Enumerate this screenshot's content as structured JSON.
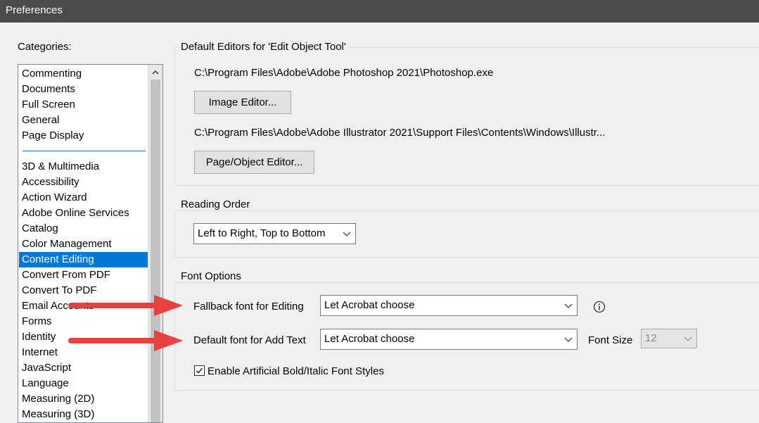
{
  "window": {
    "title": "Preferences"
  },
  "categories": {
    "label": "Categories:",
    "group1": [
      "Commenting",
      "Documents",
      "Full Screen",
      "General",
      "Page Display"
    ],
    "group2": [
      "3D & Multimedia",
      "Accessibility",
      "Action Wizard",
      "Adobe Online Services",
      "Catalog",
      "Color Management",
      "Content Editing",
      "Convert From PDF",
      "Convert To PDF",
      "Email Accounts",
      "Forms",
      "Identity",
      "Internet",
      "JavaScript",
      "Language",
      "Measuring (2D)",
      "Measuring (3D)"
    ],
    "selected": "Content Editing"
  },
  "default_editors": {
    "title": "Default Editors for 'Edit Object Tool'",
    "image_editor_path": "C:\\Program Files\\Adobe\\Adobe Photoshop 2021\\Photoshop.exe",
    "image_editor_button": "Image Editor...",
    "page_object_editor_path": "C:\\Program Files\\Adobe\\Adobe Illustrator 2021\\Support Files\\Contents\\Windows\\Illustr...",
    "page_object_editor_button": "Page/Object Editor..."
  },
  "reading_order": {
    "title": "Reading Order",
    "selected": "Left to Right, Top to Bottom"
  },
  "font_options": {
    "title": "Font Options",
    "fallback_label": "Fallback font for Editing",
    "fallback_value": "Let Acrobat choose",
    "default_label": "Default font for Add Text",
    "default_value": "Let Acrobat choose",
    "font_size_label": "Font Size",
    "font_size_value": "12",
    "bold_italic_label": "Enable Artificial Bold/Italic Font Styles",
    "bold_italic_checked": true
  },
  "colors": {
    "titlebar": "#4b4b4b",
    "selection": "#0078d7",
    "annotation_arrow": "#e8403f"
  },
  "icons": [
    "chevron-up-icon",
    "chevron-down-icon",
    "info-icon",
    "checkmark-icon"
  ]
}
